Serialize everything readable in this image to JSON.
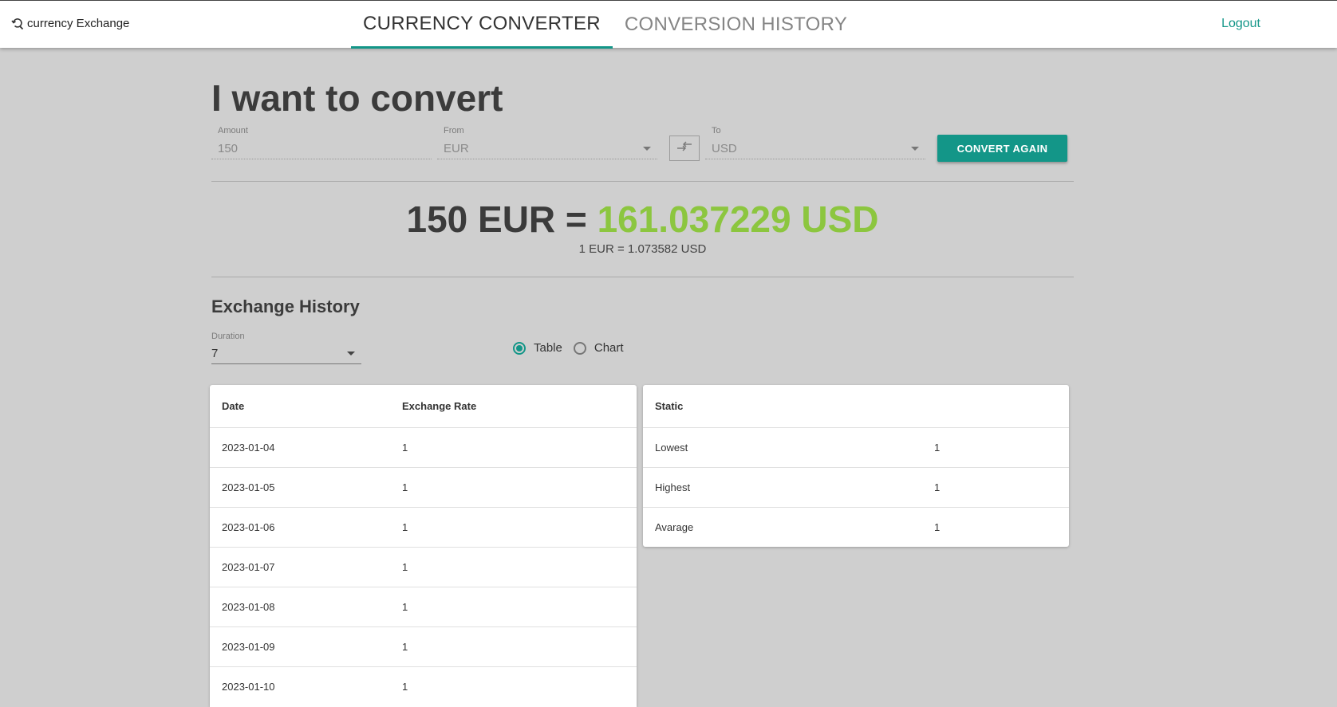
{
  "header": {
    "brand": "currency Exchange",
    "tabs": [
      "CURRENCY CONVERTER",
      "CONVERSION HISTORY"
    ],
    "active_tab": "CURRENCY CONVERTER",
    "logout": "Logout"
  },
  "converter": {
    "heading": "I want to convert",
    "amount_label": "Amount",
    "amount_value": "150",
    "from_label": "From",
    "from_value": "EUR",
    "to_label": "To",
    "to_value": "USD",
    "convert_button": "CONVERT AGAIN"
  },
  "result": {
    "input_part": "150 EUR = ",
    "output_part": "161.037229 USD",
    "rate_line": "1 EUR = 1.073582 USD"
  },
  "history": {
    "title": "Exchange History",
    "duration_label": "Duration",
    "duration_value": "7",
    "view_options": [
      "Table",
      "Chart"
    ],
    "selected_view": "Table",
    "table_headers": [
      "Date",
      "Exchange Rate"
    ],
    "rows": [
      {
        "date": "2023-01-04",
        "rate": "1"
      },
      {
        "date": "2023-01-05",
        "rate": "1"
      },
      {
        "date": "2023-01-06",
        "rate": "1"
      },
      {
        "date": "2023-01-07",
        "rate": "1"
      },
      {
        "date": "2023-01-08",
        "rate": "1"
      },
      {
        "date": "2023-01-09",
        "rate": "1"
      },
      {
        "date": "2023-01-10",
        "rate": "1"
      }
    ],
    "stats_header": "Static",
    "stats": [
      {
        "label": "Lowest",
        "value": "1"
      },
      {
        "label": "Highest",
        "value": "1"
      },
      {
        "label": "Avarage",
        "value": "1"
      }
    ]
  },
  "colors": {
    "accent": "#139688",
    "result_green": "#8cc63f",
    "background": "#cfcfcf"
  }
}
